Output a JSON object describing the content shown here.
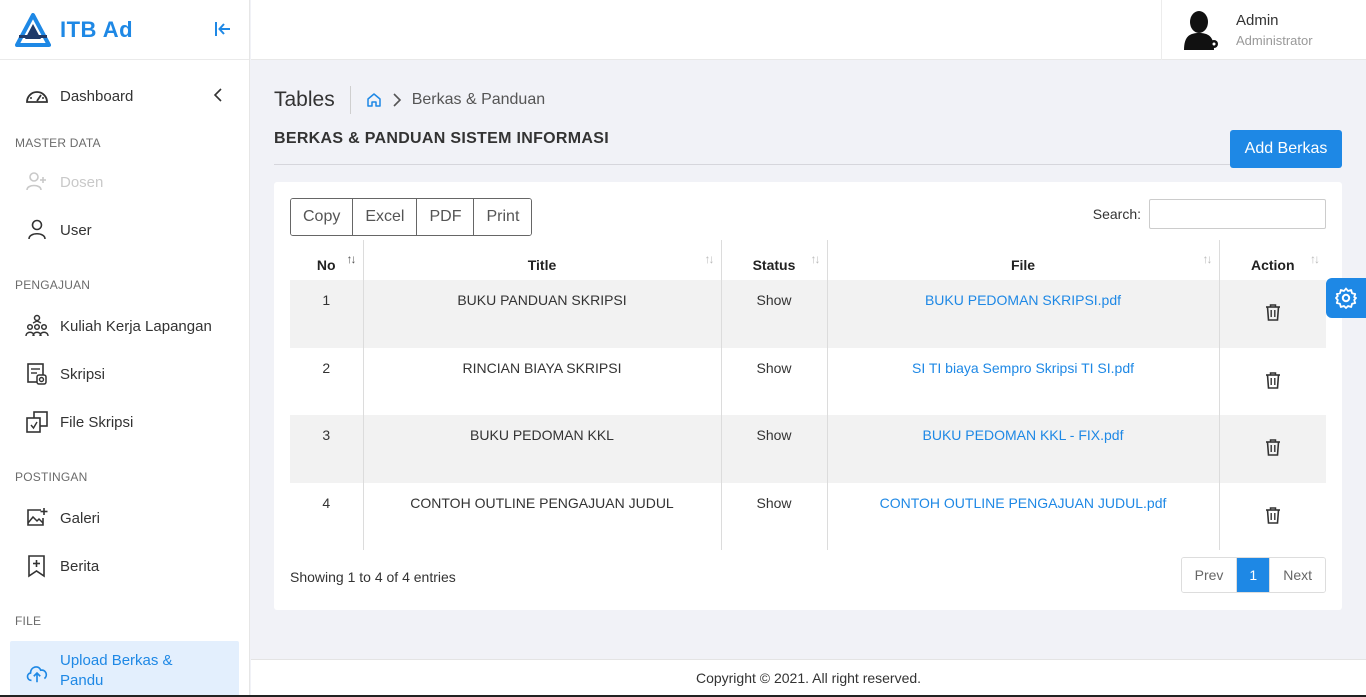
{
  "brand": {
    "name": "ITB Ad",
    "color": "#1e88e5"
  },
  "sidebar": {
    "dashboard": "Dashboard",
    "sections": {
      "master": "MASTER DATA",
      "pengajuan": "PENGAJUAN",
      "postingan": "POSTINGAN",
      "file": "FILE"
    },
    "items": {
      "dosen": "Dosen",
      "user": "User",
      "kkl": "Kuliah Kerja Lapangan",
      "skripsi": "Skripsi",
      "file_skripsi": "File Skripsi",
      "galeri": "Galeri",
      "berita": "Berita",
      "upload": "Upload Berkas & Pandu"
    }
  },
  "user": {
    "name": "Admin",
    "role": "Administrator"
  },
  "page": {
    "title": "Tables",
    "breadcrumb": "Berkas & Panduan",
    "subtitle": "BERKAS & PANDUAN SISTEM INFORMASI",
    "add_button": "Add Berkas"
  },
  "table": {
    "buttons": {
      "copy": "Copy",
      "excel": "Excel",
      "pdf": "PDF",
      "print": "Print"
    },
    "search_label": "Search:",
    "search_value": "",
    "headers": {
      "no": "No",
      "title": "Title",
      "status": "Status",
      "file": "File",
      "action": "Action"
    },
    "rows": [
      {
        "no": "1",
        "title": "BUKU PANDUAN SKRIPSI",
        "status": "Show",
        "file": "BUKU PEDOMAN SKRIPSI.pdf"
      },
      {
        "no": "2",
        "title": "RINCIAN BIAYA SKRIPSI",
        "status": "Show",
        "file": "SI TI biaya Sempro Skripsi TI SI.pdf"
      },
      {
        "no": "3",
        "title": "BUKU PEDOMAN KKL",
        "status": "Show",
        "file": "BUKU PEDOMAN KKL - FIX.pdf"
      },
      {
        "no": "4",
        "title": "CONTOH OUTLINE PENGAJUAN JUDUL",
        "status": "Show",
        "file": "CONTOH OUTLINE PENGAJUAN JUDUL.pdf"
      }
    ],
    "info": "Showing 1 to 4 of 4 entries",
    "pager": {
      "prev": "Prev",
      "current": "1",
      "next": "Next"
    }
  },
  "footer": "Copyright © 2021. All right reserved.",
  "icons": {
    "logo": "triangle-logo-icon",
    "collapse": "collapse-sidebar-icon",
    "dashboard": "speedometer-icon",
    "dosen": "user-plus-icon",
    "user": "user-icon",
    "kkl": "group-icon",
    "skripsi": "document-icon",
    "file_skripsi": "files-icon",
    "galeri": "image-add-icon",
    "berita": "news-add-icon",
    "upload": "cloud-upload-icon",
    "home": "home-icon",
    "trash": "trash-icon",
    "settings": "gear-icon"
  }
}
